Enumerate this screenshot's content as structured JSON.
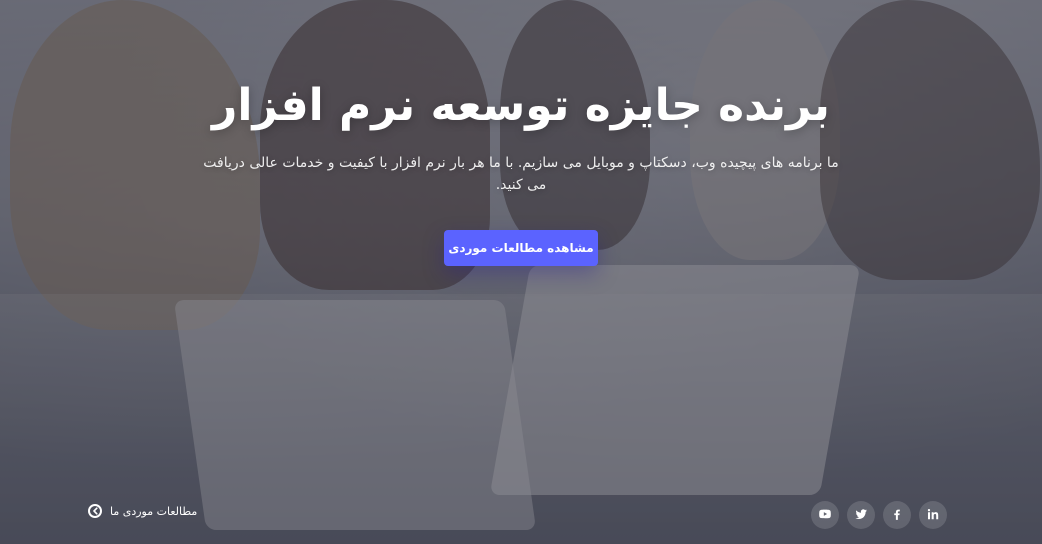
{
  "hero": {
    "title": "برنده جایزه توسعه نرم افزار",
    "subtitle": "ما برنامه های پیچیده وب، دسکتاپ و موبایل می سازیم. با ما هر بار نرم افزار با کیفیت و خدمات عالی دریافت می کنید.",
    "cta_label": "مشاهده مطالعات موردی"
  },
  "footer": {
    "case_studies_link": "مطالعات موردی ما"
  },
  "social": [
    {
      "name": "linkedin-icon",
      "label": "in"
    },
    {
      "name": "facebook-icon",
      "label": "f"
    },
    {
      "name": "twitter-icon",
      "label": "t"
    },
    {
      "name": "youtube-icon",
      "label": "▶"
    }
  ],
  "colors": {
    "accent": "#5b63ff",
    "overlay": "rgba(30,30,44,0.52)"
  }
}
